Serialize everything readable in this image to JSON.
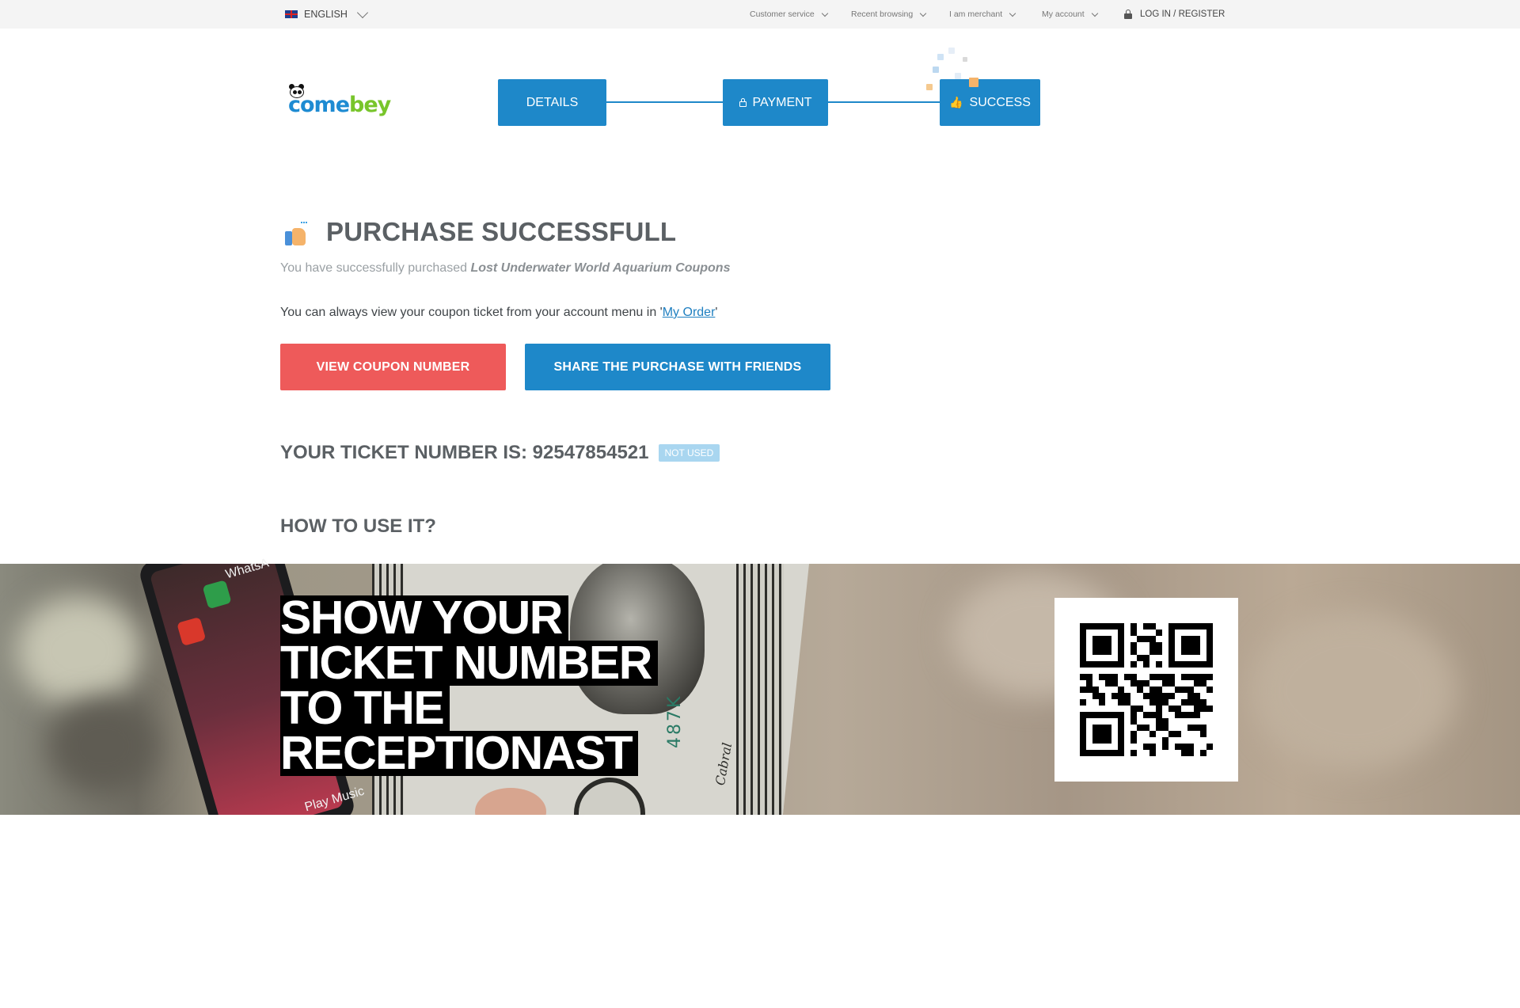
{
  "topbar": {
    "language": "ENGLISH",
    "nav": [
      {
        "label": "Customer service"
      },
      {
        "label": "Recent browsing"
      },
      {
        "label": "I am merchant"
      },
      {
        "label": "My account"
      }
    ],
    "login_label": "LOG IN / REGISTER"
  },
  "logo": {
    "part1": "come",
    "part2": "bey"
  },
  "stepper": {
    "steps": [
      {
        "label": "DETAILS",
        "icon": null
      },
      {
        "label": "PAYMENT",
        "icon": "lock-icon"
      },
      {
        "label": "SUCCESS",
        "icon": "thumbs-up-icon"
      }
    ],
    "current": "SUCCESS",
    "accent": "#1e88c9"
  },
  "purchase": {
    "title": "PURCHASE SUCCESSFULL",
    "sub_prefix": "You have successfully purchased ",
    "product_name": "Lost Underwater World Aquarium Coupons",
    "view_prefix": "You can always view your coupon ticket from  your account menu in '",
    "view_link": "My Order",
    "view_suffix": "'"
  },
  "buttons": {
    "view_coupon": "VIEW COUPON NUMBER",
    "share": "SHARE THE PURCHASE WITH FRIENDS",
    "view_coupon_color": "#ee5a5a",
    "share_color": "#1e88c9"
  },
  "ticket": {
    "label": "YOUR TICKET NUMBER IS: ",
    "number": "92547854521",
    "status": "NOT USED",
    "status_color": "#a9d6f0"
  },
  "howto": {
    "title": "HOW TO USE IT?"
  },
  "banner": {
    "lines": [
      "SHOW YOUR",
      "TICKET NUMBER",
      "TO THE",
      "RECEPTIONAST"
    ],
    "phone_top_text": "WhatsA",
    "phone_bottom_text": "Play Music",
    "bill_serial": "487K",
    "bill_signature": "Cabral"
  }
}
